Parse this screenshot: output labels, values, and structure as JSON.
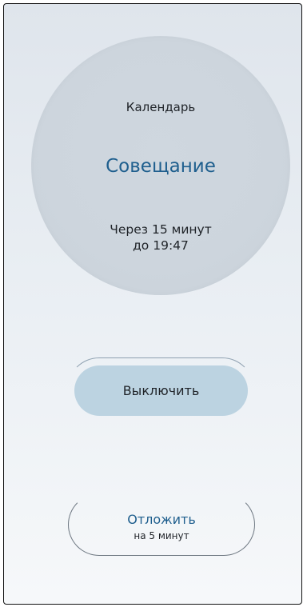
{
  "reminder": {
    "app_name": "Календарь",
    "event_title": "Совещание",
    "time_line1": "Через 15 минут",
    "time_line2": "до 19:47"
  },
  "actions": {
    "dismiss_label": "Выключить",
    "snooze_label": "Отложить",
    "snooze_sub": "на 5 минут"
  },
  "colors": {
    "accent": "#1f5f8e",
    "dismiss_bg": "#bcd3e1",
    "circle_bg": "#cdd5dd"
  }
}
